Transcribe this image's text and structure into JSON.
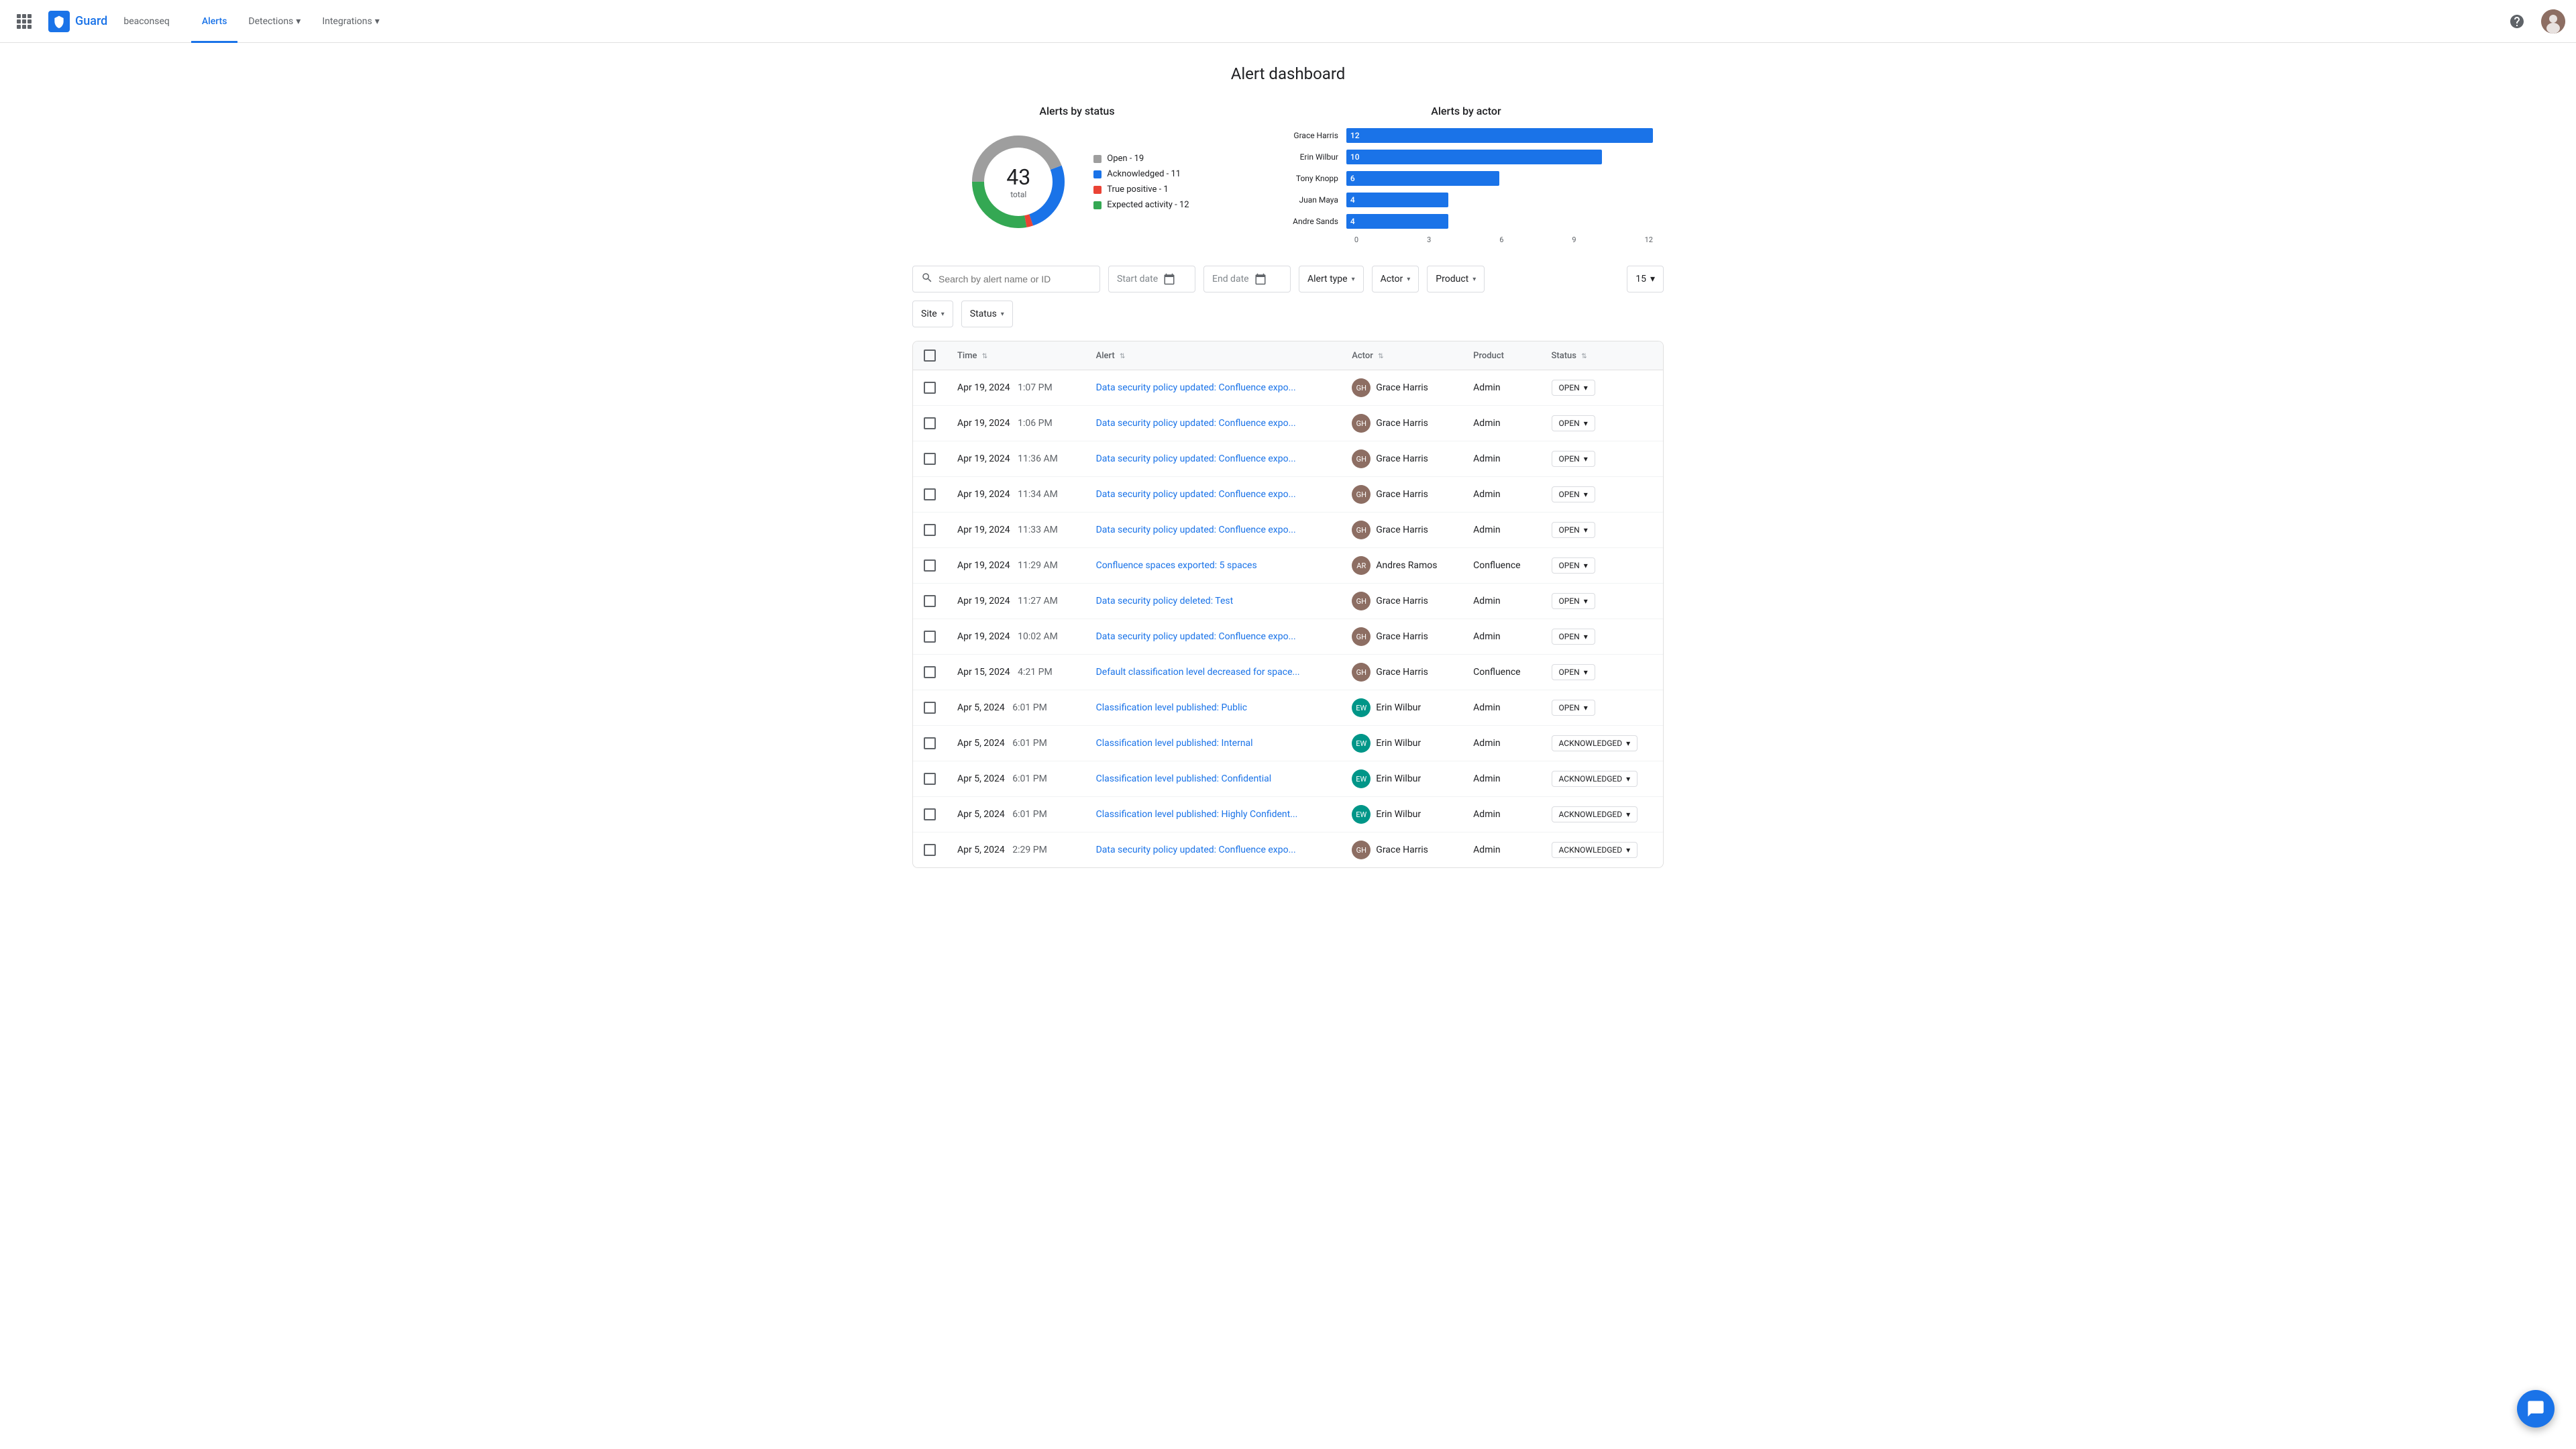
{
  "nav": {
    "app_name": "Guard",
    "tenant": "beaconseq",
    "links": [
      {
        "label": "Alerts",
        "active": true
      },
      {
        "label": "Detections",
        "has_arrow": true
      },
      {
        "label": "Integrations",
        "has_arrow": true
      }
    ]
  },
  "page": {
    "title": "Alert dashboard"
  },
  "donut_chart": {
    "title": "Alerts by status",
    "total": "43",
    "total_label": "total",
    "legend": [
      {
        "label": "Open - 19",
        "color": "#9e9e9e"
      },
      {
        "label": "Acknowledged - 11",
        "color": "#1a73e8"
      },
      {
        "label": "True positive - 1",
        "color": "#ea4335"
      },
      {
        "label": "Expected activity - 12",
        "color": "#34a853"
      }
    ]
  },
  "bar_chart": {
    "title": "Alerts by actor",
    "bars": [
      {
        "label": "Grace Harris",
        "value": 12,
        "max": 12
      },
      {
        "label": "Erin Wilbur",
        "value": 10,
        "max": 12
      },
      {
        "label": "Tony Knopp",
        "value": 6,
        "max": 12
      },
      {
        "label": "Juan Maya",
        "value": 4,
        "max": 12
      },
      {
        "label": "Andre Sands",
        "value": 4,
        "max": 12
      }
    ],
    "axis_labels": [
      "0",
      "3",
      "6",
      "9",
      "12"
    ]
  },
  "filters": {
    "search_placeholder": "Search by alert name or ID",
    "start_date_placeholder": "Start date",
    "end_date_placeholder": "End date",
    "alert_type_label": "Alert type",
    "actor_label": "Actor",
    "product_label": "Product",
    "per_page": "15",
    "site_label": "Site",
    "status_label": "Status"
  },
  "table": {
    "headers": [
      "Time",
      "Alert",
      "Actor",
      "Product",
      "Status"
    ],
    "rows": [
      {
        "date": "Apr 19, 2024",
        "time": "1:07 PM",
        "alert": "Data security policy updated: Confluence expo...",
        "actor": "Grace Harris",
        "actor_initial": "GH",
        "actor_avatar_color": "#8d6e63",
        "product": "Admin",
        "status": "OPEN"
      },
      {
        "date": "Apr 19, 2024",
        "time": "1:06 PM",
        "alert": "Data security policy updated: Confluence expo...",
        "actor": "Grace Harris",
        "actor_initial": "GH",
        "actor_avatar_color": "#8d6e63",
        "product": "Admin",
        "status": "OPEN"
      },
      {
        "date": "Apr 19, 2024",
        "time": "11:36 AM",
        "alert": "Data security policy updated: Confluence expo...",
        "actor": "Grace Harris",
        "actor_initial": "GH",
        "actor_avatar_color": "#8d6e63",
        "product": "Admin",
        "status": "OPEN"
      },
      {
        "date": "Apr 19, 2024",
        "time": "11:34 AM",
        "alert": "Data security policy updated: Confluence expo...",
        "actor": "Grace Harris",
        "actor_initial": "GH",
        "actor_avatar_color": "#8d6e63",
        "product": "Admin",
        "status": "OPEN"
      },
      {
        "date": "Apr 19, 2024",
        "time": "11:33 AM",
        "alert": "Data security policy updated: Confluence expo...",
        "actor": "Grace Harris",
        "actor_initial": "GH",
        "actor_avatar_color": "#8d6e63",
        "product": "Admin",
        "status": "OPEN"
      },
      {
        "date": "Apr 19, 2024",
        "time": "11:29 AM",
        "alert": "Confluence spaces exported: 5 spaces",
        "actor": "Andres Ramos",
        "actor_initial": "AR",
        "actor_avatar_color": "#8d6e63",
        "product": "Confluence",
        "status": "OPEN"
      },
      {
        "date": "Apr 19, 2024",
        "time": "11:27 AM",
        "alert": "Data security policy deleted: Test",
        "actor": "Grace Harris",
        "actor_initial": "GH",
        "actor_avatar_color": "#8d6e63",
        "product": "Admin",
        "status": "OPEN"
      },
      {
        "date": "Apr 19, 2024",
        "time": "10:02 AM",
        "alert": "Data security policy updated: Confluence expo...",
        "actor": "Grace Harris",
        "actor_initial": "GH",
        "actor_avatar_color": "#8d6e63",
        "product": "Admin",
        "status": "OPEN"
      },
      {
        "date": "Apr 15, 2024",
        "time": "4:21 PM",
        "alert": "Default classification level decreased for space...",
        "actor": "Grace Harris",
        "actor_initial": "GH",
        "actor_avatar_color": "#8d6e63",
        "product": "Confluence",
        "status": "OPEN"
      },
      {
        "date": "Apr 5, 2024",
        "time": "6:01 PM",
        "alert": "Classification level published: Public",
        "actor": "Erin Wilbur",
        "actor_initial": "EW",
        "actor_avatar_color": "#009688",
        "product": "Admin",
        "status": "OPEN"
      },
      {
        "date": "Apr 5, 2024",
        "time": "6:01 PM",
        "alert": "Classification level published: Internal",
        "actor": "Erin Wilbur",
        "actor_initial": "EW",
        "actor_avatar_color": "#009688",
        "product": "Admin",
        "status": "ACKNOWLEDGED"
      },
      {
        "date": "Apr 5, 2024",
        "time": "6:01 PM",
        "alert": "Classification level published: Confidential",
        "actor": "Erin Wilbur",
        "actor_initial": "EW",
        "actor_avatar_color": "#009688",
        "product": "Admin",
        "status": "ACKNOWLEDGED"
      },
      {
        "date": "Apr 5, 2024",
        "time": "6:01 PM",
        "alert": "Classification level published: Highly Confident...",
        "actor": "Erin Wilbur",
        "actor_initial": "EW",
        "actor_avatar_color": "#009688",
        "product": "Admin",
        "status": "ACKNOWLEDGED"
      },
      {
        "date": "Apr 5, 2024",
        "time": "2:29 PM",
        "alert": "Data security policy updated: Confluence expo...",
        "actor": "Grace Harris",
        "actor_initial": "GH",
        "actor_avatar_color": "#8d6e63",
        "product": "Admin",
        "status": "ACKNOWLEDGED"
      }
    ]
  }
}
